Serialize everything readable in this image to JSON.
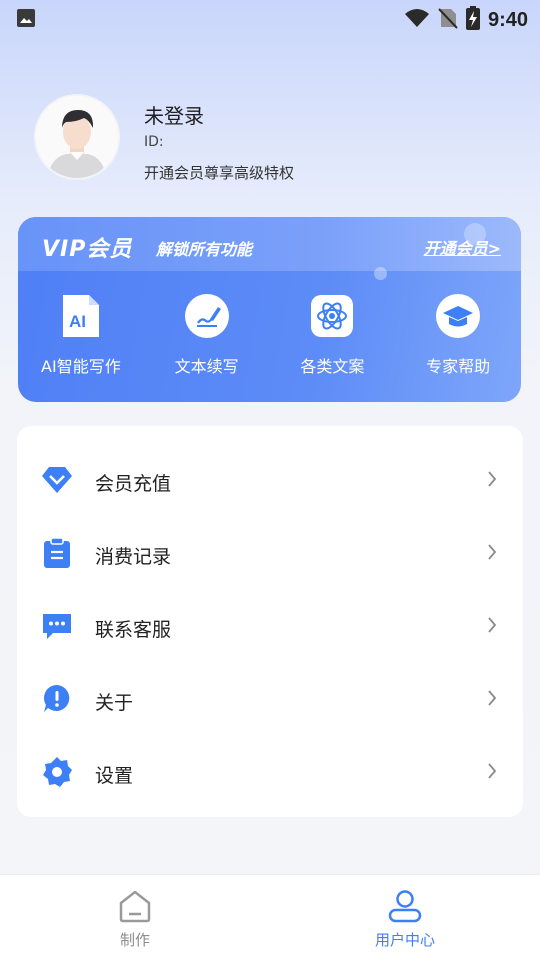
{
  "status_bar": {
    "time": "9:40"
  },
  "profile": {
    "name": "未登录",
    "id_label": "ID:",
    "hint": "开通会员尊享高级特权"
  },
  "vip": {
    "title": "VIP会员",
    "subtitle": "解锁所有功能",
    "open_link": "开通会员>",
    "features": [
      {
        "icon": "ai-document-icon",
        "label": "AI智能写作"
      },
      {
        "icon": "pen-write-icon",
        "label": "文本续写"
      },
      {
        "icon": "atom-icon",
        "label": "各类文案"
      },
      {
        "icon": "graduation-cap-icon",
        "label": "专家帮助"
      }
    ]
  },
  "menu": {
    "items": [
      {
        "icon": "diamond-icon",
        "label": "会员充值"
      },
      {
        "icon": "clipboard-icon",
        "label": "消费记录"
      },
      {
        "icon": "chat-icon",
        "label": "联系客服"
      },
      {
        "icon": "info-bubble-icon",
        "label": "关于"
      },
      {
        "icon": "gear-icon",
        "label": "设置"
      }
    ]
  },
  "tabbar": {
    "tabs": [
      {
        "icon": "home-icon",
        "label": "制作",
        "active": false
      },
      {
        "icon": "user-icon",
        "label": "用户中心",
        "active": true
      }
    ]
  },
  "colors": {
    "accent": "#3d7ff5",
    "vip_card": "#5d8cf7",
    "icon_blue": "#3d7ff5"
  }
}
